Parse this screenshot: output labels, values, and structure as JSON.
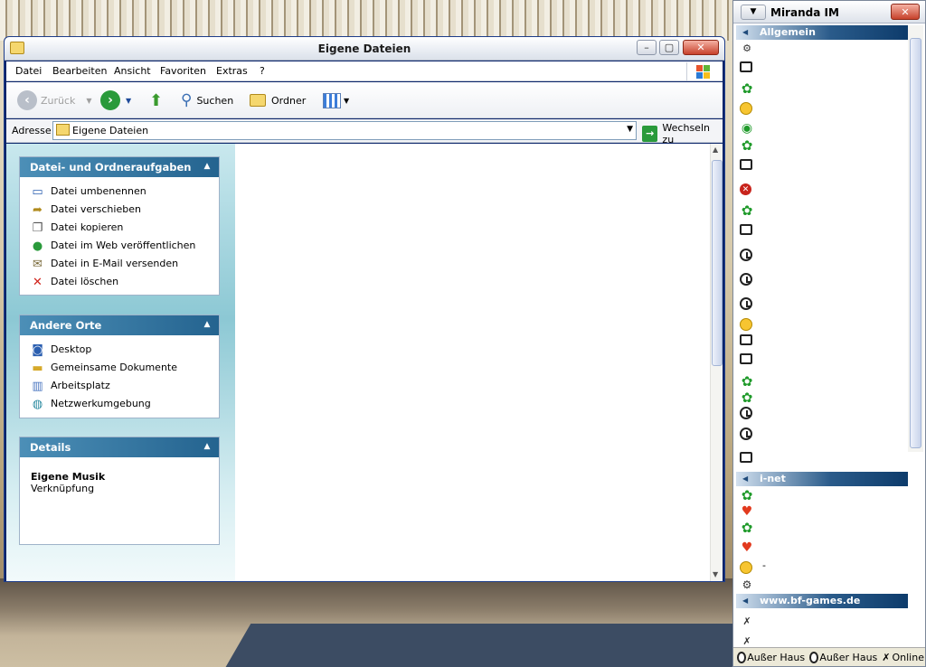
{
  "explorer": {
    "title": "Eigene Dateien",
    "menu": [
      "Datei",
      "Bearbeiten",
      "Ansicht",
      "Favoriten",
      "Extras",
      "?"
    ],
    "toolbar": {
      "back_label": "Zurück",
      "search_label": "Suchen",
      "folders_label": "Ordner"
    },
    "address": {
      "label": "Adresse",
      "value": "Eigene Dateien",
      "go_label": "Wechseln zu"
    },
    "tasks": {
      "title": "Datei- und Ordneraufgaben",
      "items": [
        "Datei umbenennen",
        "Datei verschieben",
        "Datei kopieren",
        "Datei im Web veröffentlichen",
        "Datei in E-Mail versenden",
        "Datei löschen"
      ]
    },
    "places": {
      "title": "Andere Orte",
      "items": [
        "Desktop",
        "Gemeinsame Dokumente",
        "Arbeitsplatz",
        "Netzwerkumgebung"
      ]
    },
    "details": {
      "title": "Details",
      "name": "Eigene Musik",
      "type": "Verknüpfung"
    }
  },
  "miranda": {
    "title": "Miranda IM",
    "groups": [
      "Allgemein",
      "i-net",
      "www.bf-games.de"
    ],
    "inet_contact_label": "-",
    "status": [
      {
        "label": "Außer Haus",
        "icon": "away-icon"
      },
      {
        "label": "Außer Haus",
        "icon": "away-icon"
      },
      {
        "label": "Online",
        "icon": "online-icon"
      }
    ]
  },
  "colors": {
    "accent_blue": "#24638f",
    "xp_green": "#2a9a3b",
    "close_red": "#c7412b"
  }
}
